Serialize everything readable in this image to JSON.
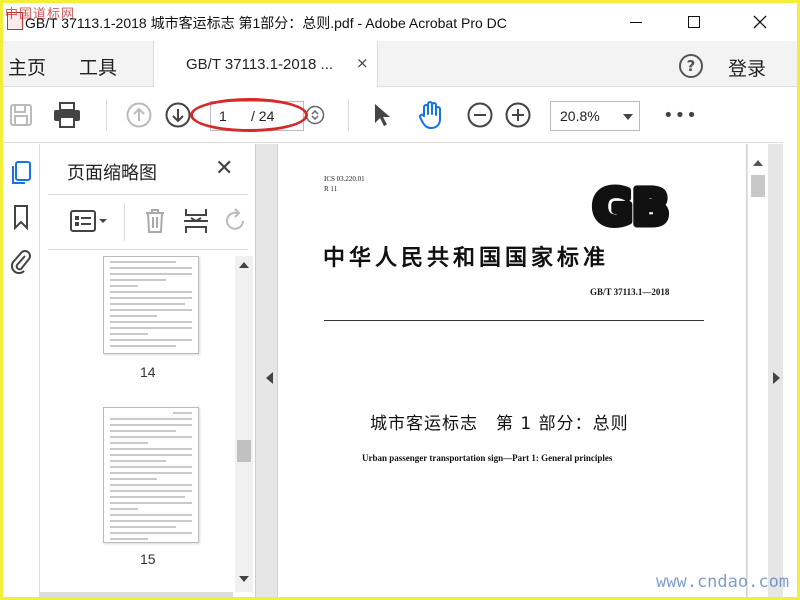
{
  "window": {
    "title": "GB/T 37113.1-2018 城市客运标志 第1部分：总则.pdf - Adobe Acrobat Pro DC",
    "watermark_top": "中国道标网"
  },
  "menu": {
    "home": "主页",
    "tools": "工具",
    "tab_label": "GB/T 37113.1-2018 ...",
    "tab_close": "×",
    "help": "?",
    "login": "登录"
  },
  "toolbar": {
    "page_current": "1",
    "page_total": "/ 24",
    "zoom": "20.8%",
    "more": "•••"
  },
  "thumbnails": {
    "title": "页面缩略图",
    "close": "✕",
    "pages": [
      {
        "num": "14"
      },
      {
        "num": "15"
      }
    ]
  },
  "document": {
    "ics_line1": "ICS 03.220.01",
    "ics_line2": "R 11",
    "logo_text": "GB",
    "main_title": "中华人民共和国国家标准",
    "standard_no": "GB/T 37113.1—2018",
    "cn_title": "城市客运标志　第 1 部分：总则",
    "en_title": "Urban passenger transportation sign—Part 1: General principles"
  },
  "watermark_bottom": "www.cndao.com",
  "colors": {
    "border": "#f2ee3a",
    "annotation_ellipse": "#d42a2a",
    "accent_blue": "#1473e6"
  }
}
